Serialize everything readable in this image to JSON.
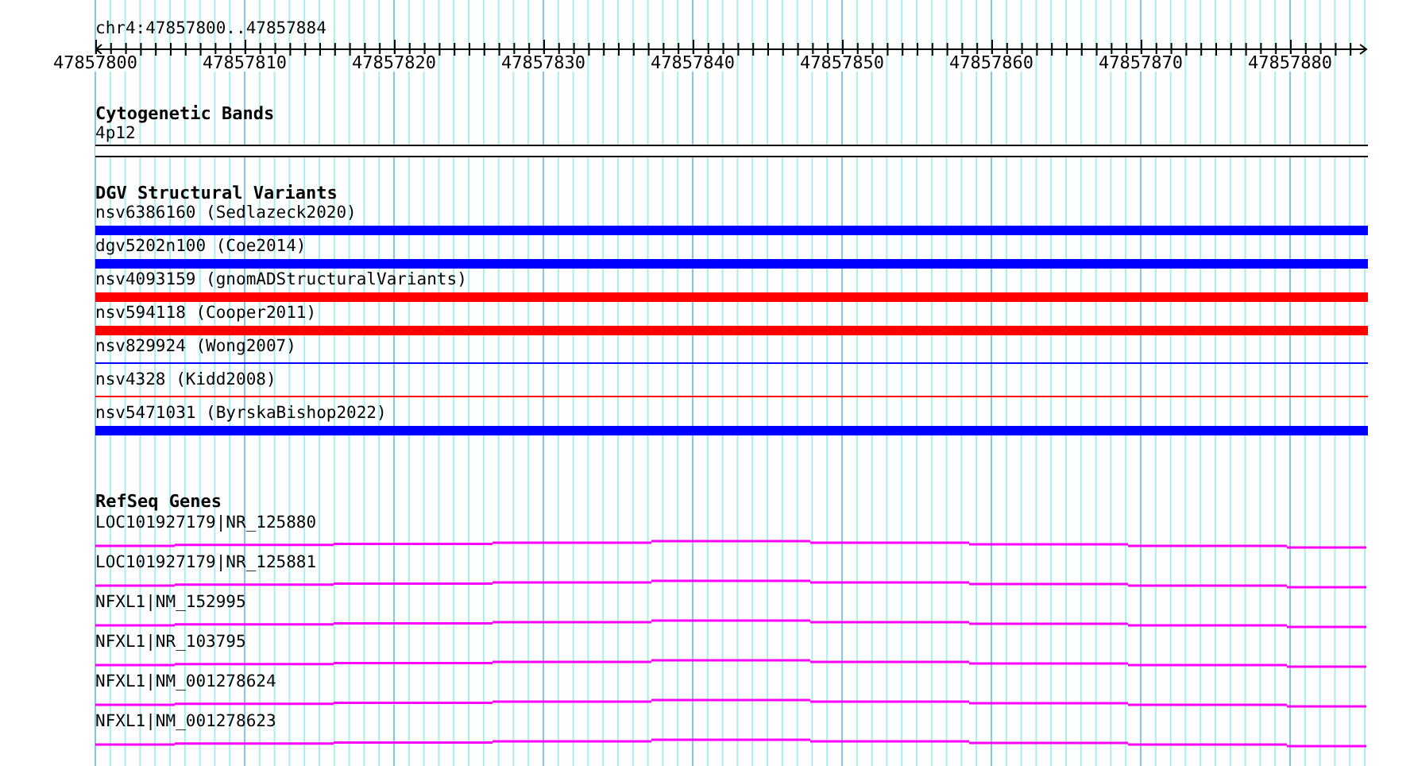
{
  "location": "chr4:47857800..47857884",
  "ruler": {
    "labels": [
      "47857800",
      "47857810",
      "47857820",
      "47857830",
      "47857840",
      "47857850",
      "47857860",
      "47857870",
      "47857880"
    ]
  },
  "tracks": [
    {
      "kind": "band",
      "title": "Cytogenetic Bands",
      "features": [
        {
          "name": "4p12"
        }
      ]
    },
    {
      "kind": "variant",
      "title": "DGV Structural Variants",
      "features": [
        {
          "name": "nsv6386160 (Sedlazeck2020)",
          "color": "#0000ff",
          "kind": "bar"
        },
        {
          "name": "dgv5202n100 (Coe2014)",
          "color": "#0000ff",
          "kind": "bar"
        },
        {
          "name": "nsv4093159 (gnomADStructuralVariants)",
          "color": "#ff0000",
          "kind": "bar"
        },
        {
          "name": "nsv594118 (Cooper2011)",
          "color": "#ff0000",
          "kind": "bar"
        },
        {
          "name": "nsv829924 (Wong2007)",
          "color": "#0000ff",
          "kind": "line"
        },
        {
          "name": "nsv4328 (Kidd2008)",
          "color": "#ff0000",
          "kind": "line"
        },
        {
          "name": "nsv5471031 (ByrskaBishop2022)",
          "color": "#0000ff",
          "kind": "bar"
        }
      ]
    },
    {
      "kind": "gene",
      "title": "RefSeq Genes",
      "features": [
        {
          "name": "LOC101927179|NR_125880"
        },
        {
          "name": "LOC101927179|NR_125881"
        },
        {
          "name": "NFXL1|NM_152995"
        },
        {
          "name": "NFXL1|NR_103795"
        },
        {
          "name": "NFXL1|NM_001278624"
        },
        {
          "name": "NFXL1|NM_001278623"
        }
      ]
    }
  ]
}
